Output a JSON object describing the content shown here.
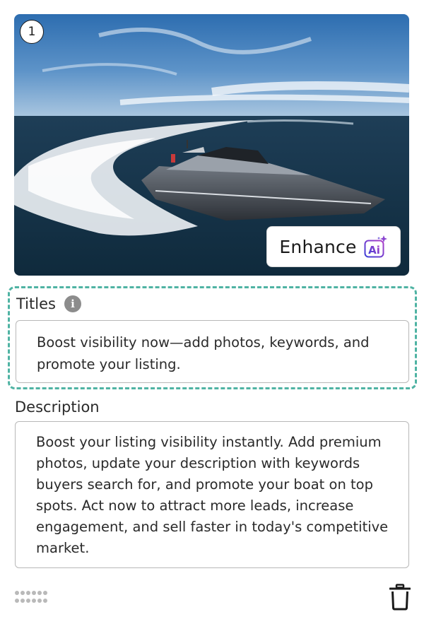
{
  "listing": {
    "index": "1",
    "enhance_label": "Enhance",
    "ai_badge_text": "Ai",
    "titles": {
      "label": "Titles",
      "value": "Boost visibility now—add photos, keywords, and promote your listing."
    },
    "description": {
      "label": "Description",
      "value": "Boost your listing visibility instantly. Add premium photos, update your description with keywords buyers search for, and promote your boat on top spots. Act now to attract more leads, increase engagement, and sell faster in today's competitive market."
    }
  },
  "icons": {
    "info": "info-icon",
    "ai": "ai-sparkle-icon",
    "drag": "drag-handle-icon",
    "delete": "trash-icon"
  },
  "colors": {
    "highlight_border": "#4fb3a3",
    "ai_gradient_start": "#3b3fd6",
    "ai_gradient_end": "#b03fc8"
  }
}
